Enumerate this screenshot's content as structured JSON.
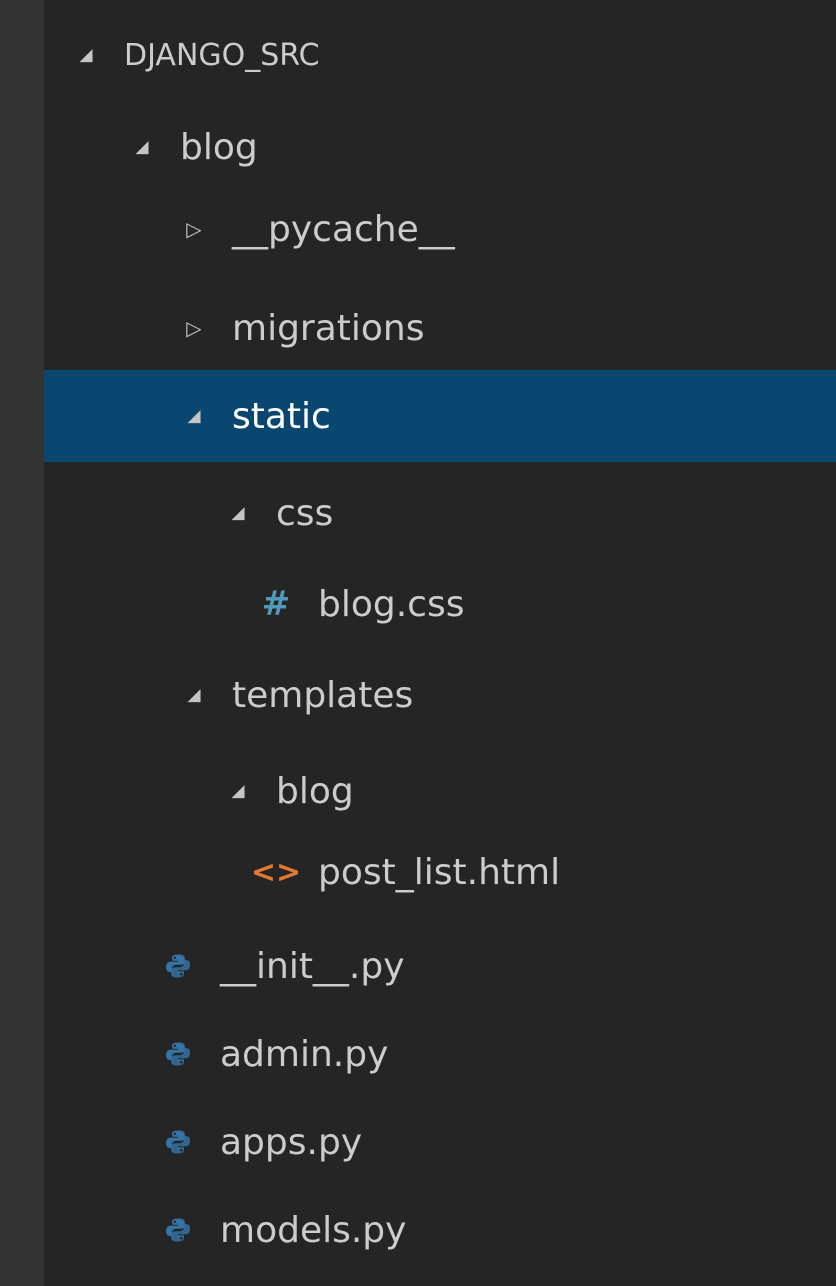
{
  "explorer": {
    "root_folder": "DJANGO_SRC",
    "items": [
      {
        "label": "blog",
        "kind": "folder",
        "state": "expanded"
      },
      {
        "label": "__pycache__",
        "kind": "folder",
        "state": "collapsed"
      },
      {
        "label": "migrations",
        "kind": "folder",
        "state": "collapsed"
      },
      {
        "label": "static",
        "kind": "folder",
        "state": "expanded",
        "selected": true
      },
      {
        "label": "css",
        "kind": "folder",
        "state": "expanded"
      },
      {
        "label": "blog.css",
        "kind": "file",
        "icon": "css-hash-icon"
      },
      {
        "label": "templates",
        "kind": "folder",
        "state": "expanded"
      },
      {
        "label": "blog",
        "kind": "folder",
        "state": "expanded"
      },
      {
        "label": "post_list.html",
        "kind": "file",
        "icon": "html-icon"
      },
      {
        "label": "__init__.py",
        "kind": "file",
        "icon": "python-icon"
      },
      {
        "label": "admin.py",
        "kind": "file",
        "icon": "python-icon"
      },
      {
        "label": "apps.py",
        "kind": "file",
        "icon": "python-icon"
      },
      {
        "label": "models.py",
        "kind": "file",
        "icon": "python-icon"
      }
    ]
  },
  "colors": {
    "background": "#252526",
    "selection": "#094771",
    "text": "#cccccc",
    "python_blue": "#3572a5",
    "python_yellow": "#e5c74a",
    "css_hash": "#519aba",
    "html_orange": "#e37933"
  }
}
